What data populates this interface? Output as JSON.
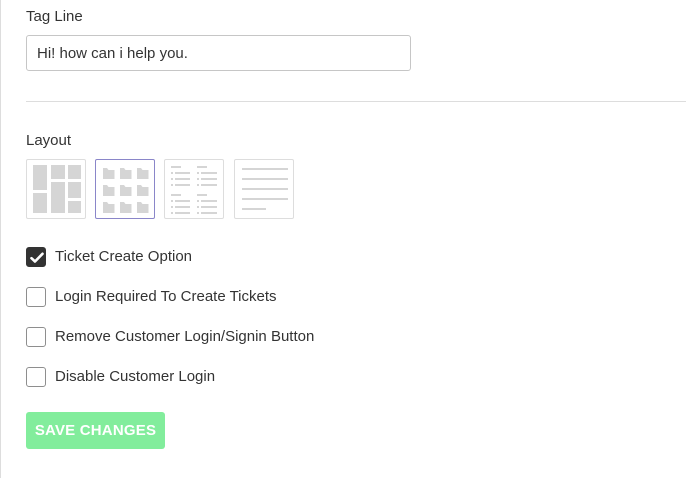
{
  "tagline": {
    "label": "Tag Line",
    "value": "Hi! how can i help you."
  },
  "layout": {
    "label": "Layout",
    "options": [
      {
        "icon": "two-column-tiles-layout-icon",
        "selected": false
      },
      {
        "icon": "folder-grid-layout-icon",
        "selected": true
      },
      {
        "icon": "two-column-list-layout-icon",
        "selected": false
      },
      {
        "icon": "single-column-list-layout-icon",
        "selected": false
      }
    ]
  },
  "options": [
    {
      "label": "Ticket Create Option",
      "checked": true
    },
    {
      "label": "Login Required To Create Tickets",
      "checked": false
    },
    {
      "label": "Remove Customer Login/Signin Button",
      "checked": false
    },
    {
      "label": "Disable Customer Login",
      "checked": false
    }
  ],
  "save_button": {
    "label": "SAVE CHANGES",
    "color": "#82ed9c",
    "disabled": true
  },
  "colors": {
    "selected_layout_border": "#8a86c9",
    "checked_box": "#333333",
    "icon_gray": "#d5d5d5"
  }
}
